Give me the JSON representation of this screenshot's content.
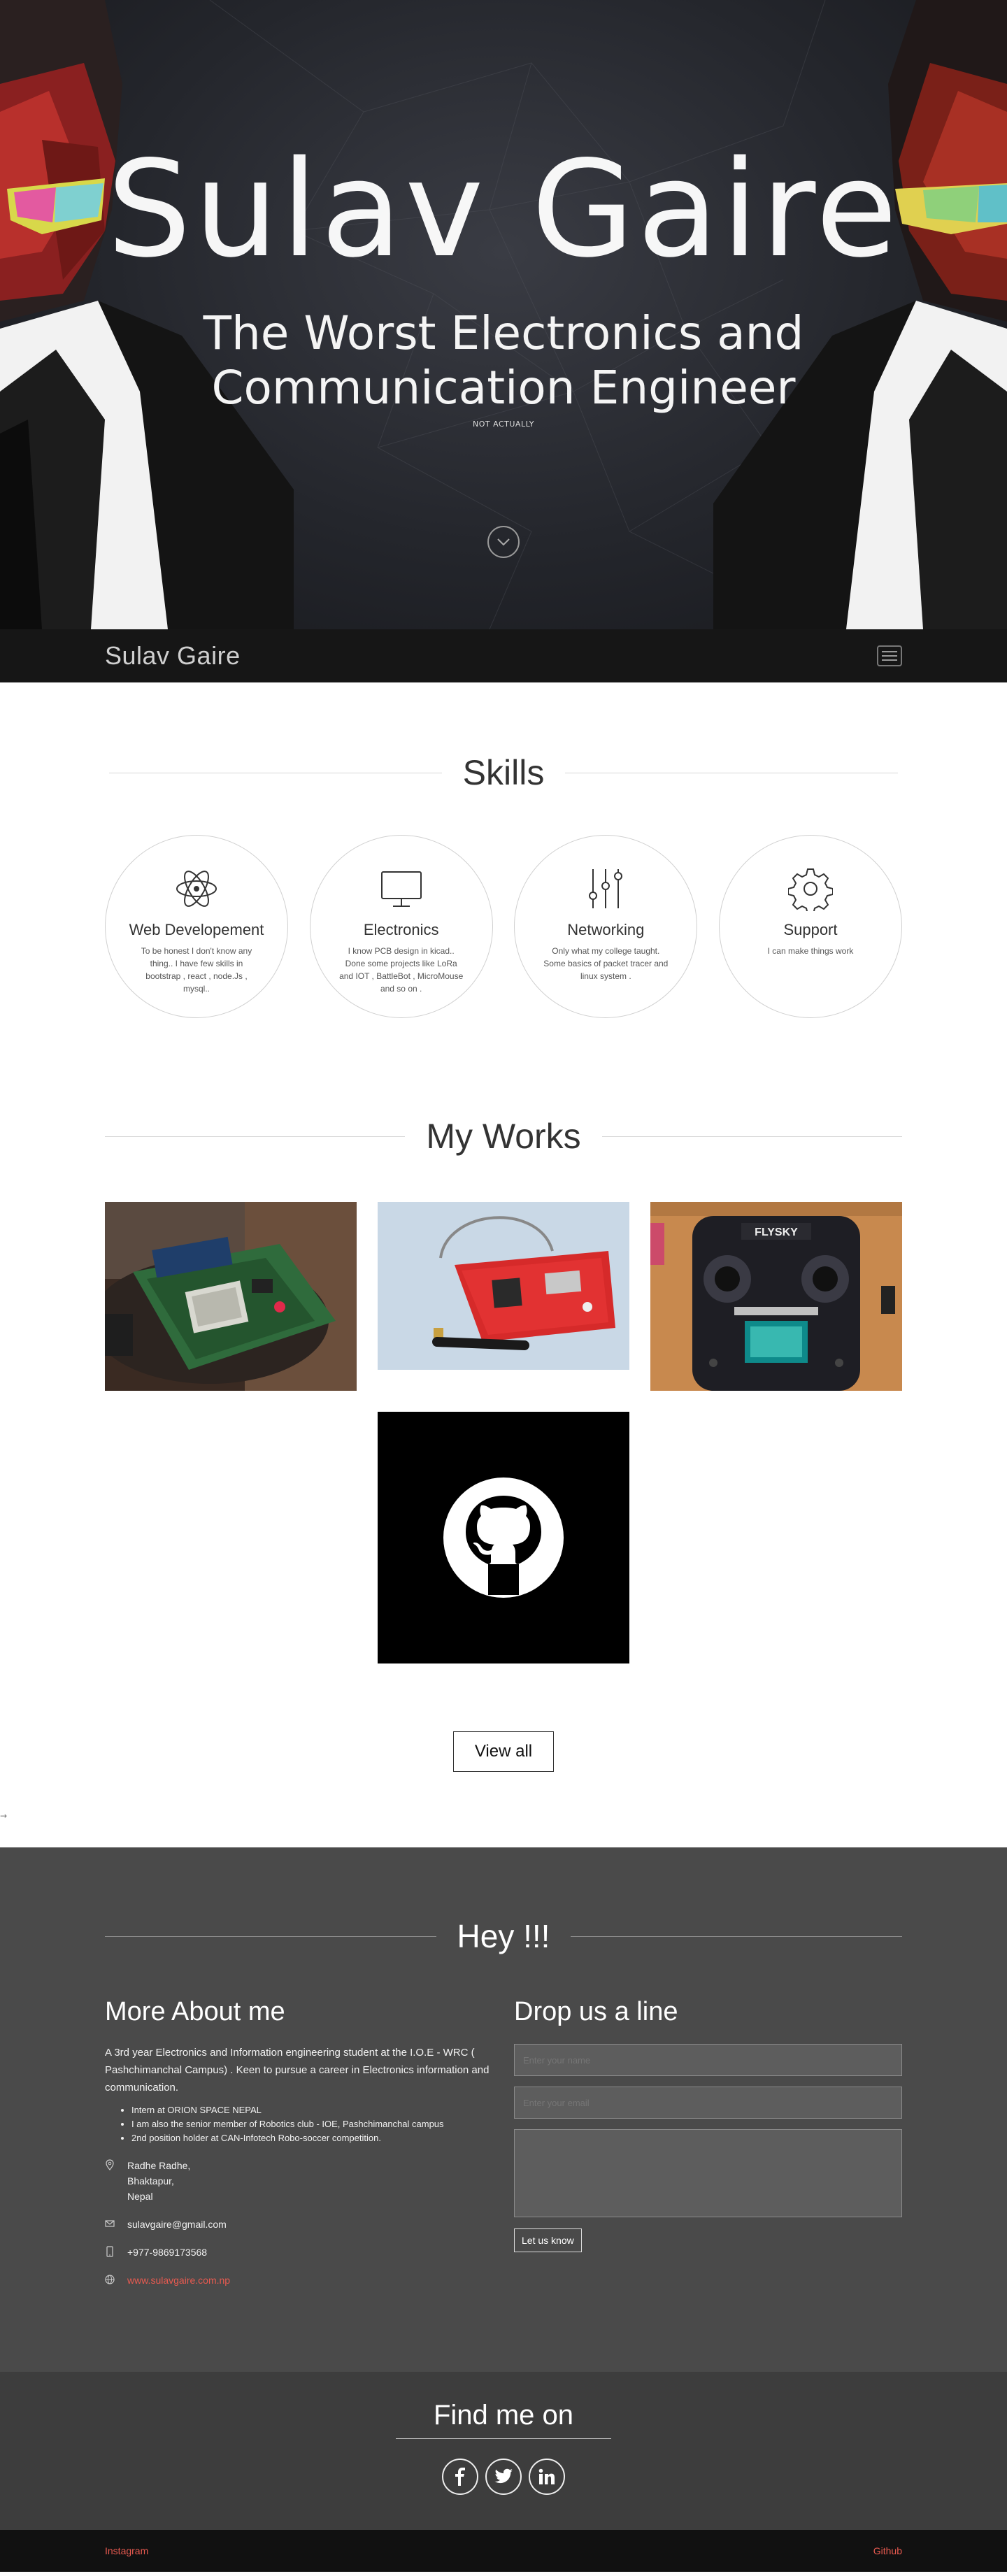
{
  "hero": {
    "title": "Sulav Gaire",
    "subtitle": "The Worst Electronics and Communication Engineer",
    "note": "NOT ACTUALLY",
    "scroll_icon": "chevron-down-icon"
  },
  "nav": {
    "brand": "Sulav Gaire",
    "menu_icon": "hamburger-icon"
  },
  "skills": {
    "heading": "Skills",
    "items": [
      {
        "icon": "atom-icon",
        "title": "Web Developement",
        "desc": "To be honest I don't know any thing.. I have few skills in bootstrap , react , node.Js , mysql.."
      },
      {
        "icon": "monitor-icon",
        "title": "Electronics",
        "desc": "I know PCB design in kicad.. Done some projects like LoRa and IOT , BattleBot , MicroMouse and so on ."
      },
      {
        "icon": "sliders-icon",
        "title": "Networking",
        "desc": "Only what my college taught. Some basics of packet tracer and linux system ."
      },
      {
        "icon": "gear-icon",
        "title": "Support",
        "desc": "I can make things work"
      }
    ]
  },
  "works": {
    "heading": "My Works",
    "view_all": "View all",
    "items": [
      "lora-board-photo",
      "red-pcb-photo",
      "flysky-transmitter-photo",
      "github-logo"
    ]
  },
  "arrow_mark": "→",
  "about": {
    "heading": "Hey !!!",
    "left_title": "More About me",
    "text": "A 3rd year Electronics and Information engineering student at the I.O.E - WRC ( Pashchimanchal Campus) . Keen to pursue a career in Electronics information and communication.",
    "list": [
      "Intern at ORION SPACE NEPAL",
      "I am also the senior member of Robotics club - IOE, Pashchimanchal campus",
      "2nd position holder at CAN-Infotech Robo-soccer competition."
    ],
    "address_lines": [
      "Radhe Radhe,",
      "Bhaktapur,",
      "Nepal"
    ],
    "email": "sulavgaire@gmail.com",
    "phone": "+977-9869173568",
    "website": "www.sulavgaire.com.np",
    "right_title": "Drop us a line",
    "name_placeholder": "Enter your name",
    "email_placeholder": "Enter your email",
    "submit": "Let us know"
  },
  "findme": {
    "heading": "Find me on",
    "icons": [
      "facebook-icon",
      "twitter-icon",
      "linkedin-icon"
    ]
  },
  "footer": {
    "left": "Instagram",
    "right": "Github"
  },
  "colors": {
    "accent": "#e85a50",
    "about_bg": "#4a4a4a",
    "findme_bg": "#3d3d3d",
    "footer_bg": "#111111"
  }
}
